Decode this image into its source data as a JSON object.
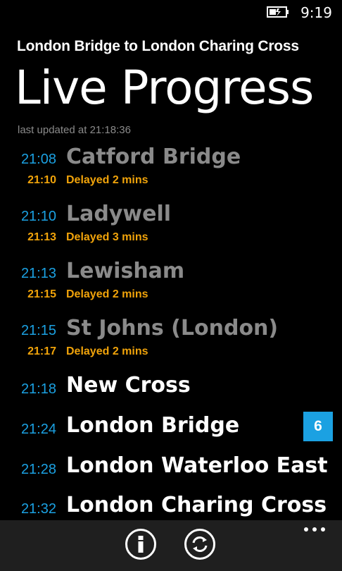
{
  "status_bar": {
    "battery_icon": "battery-charging-icon",
    "time": "9:19"
  },
  "header": {
    "route": "London Bridge to London Charing Cross",
    "title": "Live Progress",
    "last_updated": "last updated at 21:18:36"
  },
  "stops": [
    {
      "scheduled": "21:08",
      "name": "Catford Bridge",
      "actual": "21:10",
      "status": "Delayed 2 mins",
      "passed": true
    },
    {
      "scheduled": "21:10",
      "name": "Ladywell",
      "actual": "21:13",
      "status": "Delayed 3 mins",
      "passed": true
    },
    {
      "scheduled": "21:13",
      "name": "Lewisham",
      "actual": "21:15",
      "status": "Delayed 2 mins",
      "passed": true
    },
    {
      "scheduled": "21:15",
      "name": "St Johns (London)",
      "actual": "21:17",
      "status": "Delayed 2 mins",
      "passed": true
    },
    {
      "scheduled": "21:18",
      "name": "New Cross",
      "passed": false
    },
    {
      "scheduled": "21:24",
      "name": "London Bridge",
      "platform": "6",
      "passed": false
    },
    {
      "scheduled": "21:28",
      "name": "London Waterloo East",
      "passed": false
    },
    {
      "scheduled": "21:32",
      "name": "London Charing Cross",
      "passed": false
    }
  ],
  "app_bar": {
    "buttons": [
      {
        "icon": "info-icon"
      },
      {
        "icon": "refresh-icon"
      }
    ],
    "more_icon": "ellipsis-icon"
  },
  "colors": {
    "accent": "#1ba1e2",
    "delay": "#f0a30a",
    "passed_station": "#8a8a8a",
    "background": "#000000",
    "app_bar": "#1f1f1f"
  }
}
